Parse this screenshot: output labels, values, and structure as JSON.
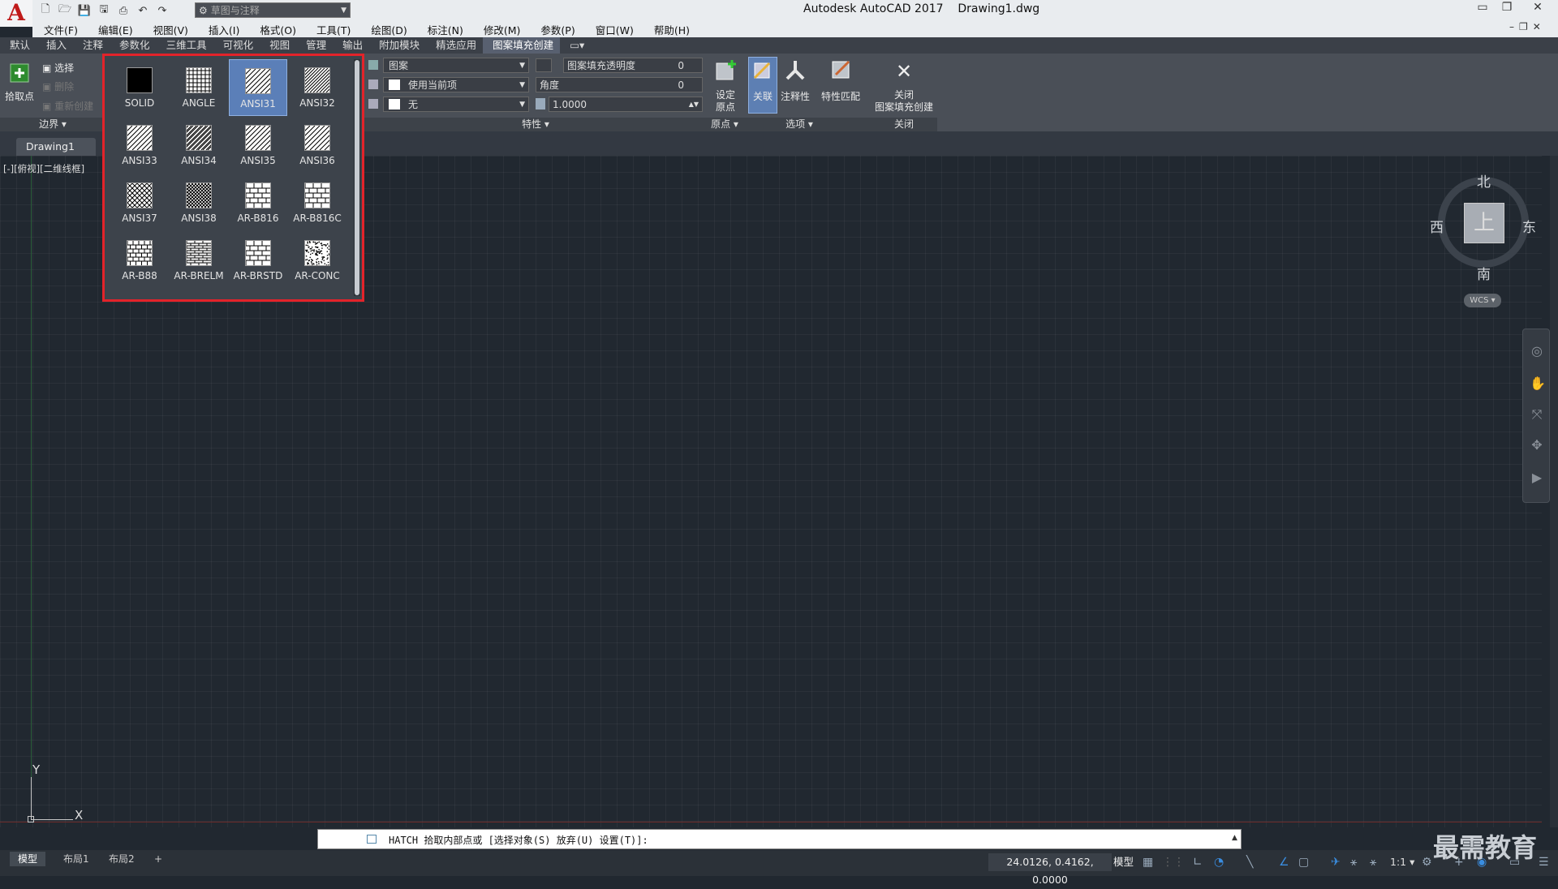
{
  "app": {
    "logo": "A",
    "title": "Autodesk AutoCAD 2017",
    "filename": "Drawing1.dwg",
    "workspace": "草图与注释"
  },
  "menu": [
    "文件(F)",
    "编辑(E)",
    "视图(V)",
    "插入(I)",
    "格式(O)",
    "工具(T)",
    "绘图(D)",
    "标注(N)",
    "修改(M)",
    "参数(P)",
    "窗口(W)",
    "帮助(H)"
  ],
  "ribbon_tabs": [
    "默认",
    "插入",
    "注释",
    "参数化",
    "三维工具",
    "可视化",
    "视图",
    "管理",
    "输出",
    "附加模块",
    "精选应用",
    "图案填充创建"
  ],
  "active_ribbon_tab": "图案填充创建",
  "ribbon": {
    "boundary": {
      "pick_points": "拾取点",
      "select": "选择",
      "remove": "删除",
      "recreate": "重新创建",
      "panel": "边界 ▾"
    },
    "properties": {
      "type": "图案",
      "color": "使用当前项",
      "background": "无",
      "transparency_label": "图案填充透明度",
      "transparency_value": "0",
      "angle_label": "角度",
      "angle_value": "0",
      "scale_value": "1.0000",
      "panel": "特性 ▾"
    },
    "origin": {
      "set_line1": "设定",
      "set_line2": "原点",
      "panel": "原点 ▾"
    },
    "options": {
      "associative": "关联",
      "annotative": "注释性",
      "match": "特性匹配",
      "panel": "选项 ▾"
    },
    "close": {
      "line1": "关闭",
      "line2": "图案填充创建",
      "panel": "关闭"
    }
  },
  "patterns": [
    {
      "name": "SOLID",
      "fill": "solid"
    },
    {
      "name": "ANGLE",
      "fill": "grid"
    },
    {
      "name": "ANSI31",
      "fill": "diag"
    },
    {
      "name": "ANSI32",
      "fill": "diag-dense"
    },
    {
      "name": "ANSI33",
      "fill": "diag-dash"
    },
    {
      "name": "ANSI34",
      "fill": "diag-double"
    },
    {
      "name": "ANSI35",
      "fill": "diag-alt"
    },
    {
      "name": "ANSI36",
      "fill": "diag-dot"
    },
    {
      "name": "ANSI37",
      "fill": "cross"
    },
    {
      "name": "ANSI38",
      "fill": "cross-dense"
    },
    {
      "name": "AR-B816",
      "fill": "brick"
    },
    {
      "name": "AR-B816C",
      "fill": "brick"
    },
    {
      "name": "AR-B88",
      "fill": "brick-small"
    },
    {
      "name": "AR-BRELM",
      "fill": "brick-thin"
    },
    {
      "name": "AR-BRSTD",
      "fill": "brick-std"
    },
    {
      "name": "AR-CONC",
      "fill": "conc"
    }
  ],
  "selected_pattern": "ANSI31",
  "doc_tab": "Drawing1",
  "viewport_label": "[-][俯视][二维线框]",
  "viewcube": {
    "north": "北",
    "south": "南",
    "east": "东",
    "west": "西",
    "face": "上",
    "wcs": "WCS ▾"
  },
  "ucs": {
    "x": "X",
    "y": "Y"
  },
  "command": {
    "text": "HATCH 拾取内部点或 [选择对象(S) 放弃(U) 设置(T)]:"
  },
  "layout_tabs": [
    "模型",
    "布局1",
    "布局2",
    "+"
  ],
  "status": {
    "coords": "24.0126, 0.4162, 0.0000",
    "model": "模型",
    "scale": "1:1 ▾"
  },
  "watermark": "最需教育",
  "colors": {
    "selection_red": "#e3232a",
    "canvas": "#212830",
    "selected_tile": "#5b7fb8"
  }
}
